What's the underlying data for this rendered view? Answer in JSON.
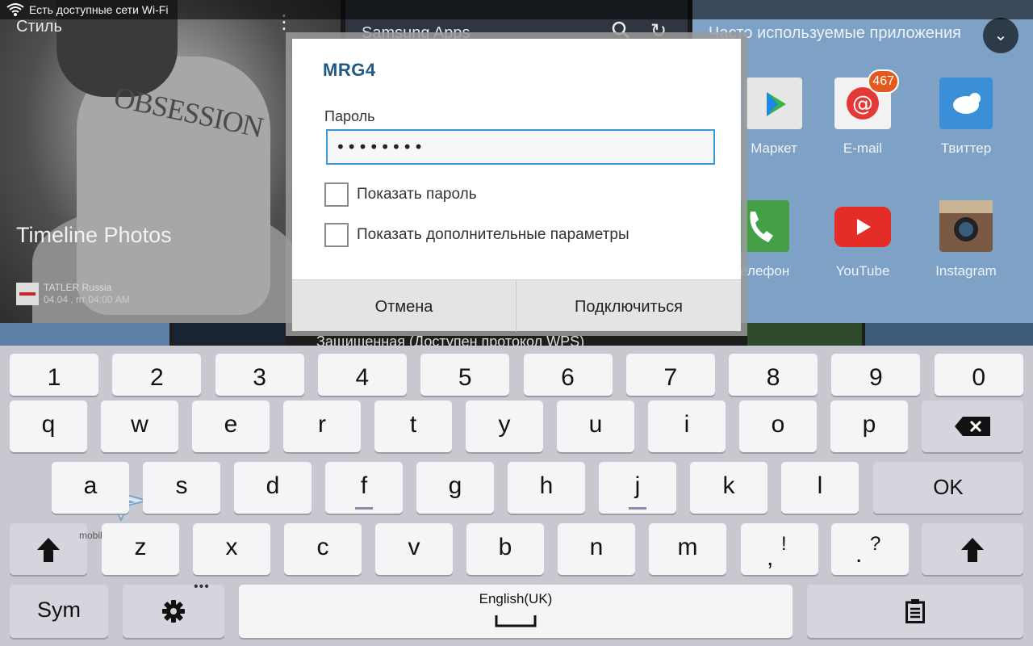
{
  "status_bar": {
    "wifi_notice": "Есть доступные сети Wi-Fi"
  },
  "background": {
    "style_panel": {
      "title": "Стиль",
      "sweater_text": "OBSESSION",
      "story_title": "Timeline Photos",
      "source_name": "TATLER Russia",
      "source_time": "04.04 , пт 04:00 AM"
    },
    "samsung_panel": {
      "title": "Samsung Apps"
    },
    "apps_panel": {
      "title": "Часто используемые приложения",
      "apps": [
        {
          "label": "Маркет",
          "icon": "play-store-icon"
        },
        {
          "label": "E-mail",
          "icon": "email-icon",
          "badge": "467"
        },
        {
          "label": "Твиттер",
          "icon": "twitter-icon"
        },
        {
          "label": "Телефон",
          "icon": "phone-icon"
        },
        {
          "label": "YouTube",
          "icon": "youtube-icon"
        },
        {
          "label": "Instagram",
          "icon": "instagram-icon"
        }
      ]
    },
    "behind_dialog_text": "Защищенная (Доступен протокол WPS)"
  },
  "dialog": {
    "title": "MRG4",
    "password_label": "Пароль",
    "password_value": "••••••••",
    "show_password_label": "Показать пароль",
    "show_advanced_label": "Показать дополнительные параметры",
    "cancel_label": "Отмена",
    "connect_label": "Подключиться"
  },
  "keyboard": {
    "row1": [
      "1",
      "2",
      "3",
      "4",
      "5",
      "6",
      "7",
      "8",
      "9",
      "0"
    ],
    "row2": [
      "q",
      "w",
      "e",
      "r",
      "t",
      "y",
      "u",
      "i",
      "o",
      "p"
    ],
    "row3": [
      "a",
      "s",
      "d",
      "f",
      "g",
      "h",
      "j",
      "k",
      "l"
    ],
    "row4": [
      "z",
      "x",
      "c",
      "v",
      "b",
      "n",
      "m"
    ],
    "comma": ",",
    "comma_alt": "!",
    "period": ".",
    "period_alt": "?",
    "ok_label": "OK",
    "sym_label": "Sym",
    "language_label": "English(UK)",
    "settings_more": "•••"
  },
  "watermark": "mobile-review.com",
  "colors": {
    "accent": "#3a9ad9",
    "title_blue": "#1e5a85",
    "email_badge": "#e35a1f"
  }
}
